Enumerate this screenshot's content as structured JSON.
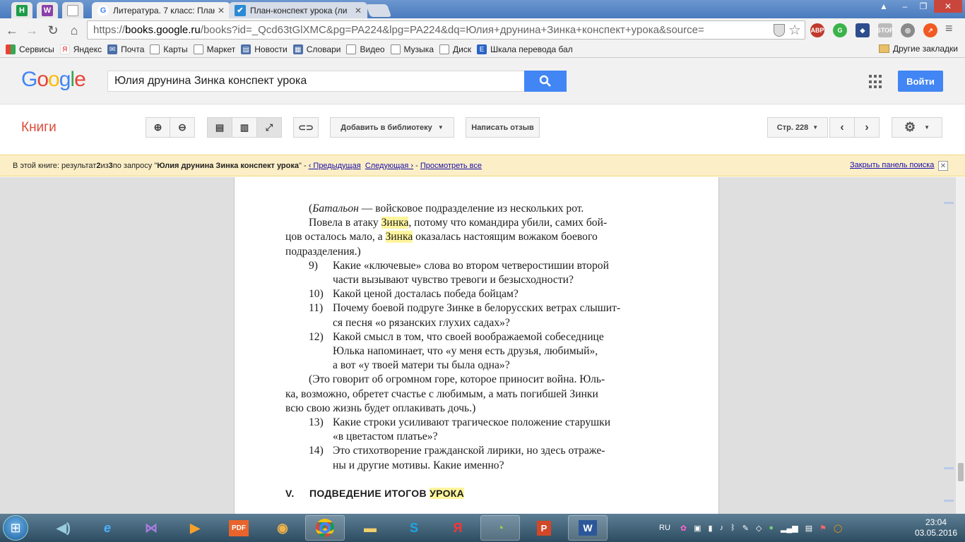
{
  "tabs": [
    {
      "title": "Литература. 7 класс: План",
      "favicon": "google-g-icon"
    },
    {
      "title": "План-конспект урока (ли",
      "favicon": "checkbox-icon"
    }
  ],
  "address": {
    "prefix": "https://",
    "domain": "books.google.ru",
    "path": "/books?id=_Qcd63tGlXMC&pg=PA224&lpg=PA224&dq=Юлия+друнина+Зинка+конспект+урока&source="
  },
  "bookmarks": [
    {
      "label": "Сервисы",
      "icon": "apps-icon",
      "color": "#e94235"
    },
    {
      "label": "Яндекс",
      "icon": "yandex-icon",
      "color": "#e51c23"
    },
    {
      "label": "Почта",
      "icon": "mail-icon",
      "color": "#4c6fa8"
    },
    {
      "label": "Карты",
      "icon": "page-icon",
      "color": "#ffffff"
    },
    {
      "label": "Маркет",
      "icon": "page-icon",
      "color": "#ffffff"
    },
    {
      "label": "Новости",
      "icon": "news-icon",
      "color": "#4c6fa8"
    },
    {
      "label": "Словари",
      "icon": "dictionary-icon",
      "color": "#4c6fa8"
    },
    {
      "label": "Видео",
      "icon": "page-icon",
      "color": "#ffffff"
    },
    {
      "label": "Музыка",
      "icon": "page-icon",
      "color": "#ffffff"
    },
    {
      "label": "Диск",
      "icon": "page-icon",
      "color": "#ffffff"
    },
    {
      "label": "Шкала перевода бал",
      "icon": "scale-icon",
      "color": "#2a64c5"
    }
  ],
  "other_bookmarks": "Другие закладки",
  "google": {
    "logo": "Google",
    "search_value": "Юлия друнина Зинка конспект урока",
    "signin": "Войти"
  },
  "books": {
    "label": "Книги",
    "add_library": "Добавить в библиотеку",
    "write_review": "Написать отзыв",
    "page_select": "Стр. 228"
  },
  "results_bar": {
    "prefix": "В этой книге: результат ",
    "current": "2",
    "of": " из ",
    "total": "3",
    "query_prefix": " по запросу \"",
    "query": "Юлия друнина Зинка конспект урока",
    "query_suffix": "\"",
    "sep1": " - ",
    "prev": "‹ Предыдущая",
    "next": "Следующая ›",
    "sep2": " - ",
    "view_all": "Просмотреть все",
    "close": "Закрыть панель поиска"
  },
  "book_text": {
    "l1a": "(",
    "l1b": "Батальон",
    "l1c": " — войсковое подразделение из нескольких рот.",
    "l2a": "Повела в атаку ",
    "l2hl": "Зинка",
    "l2b": ", потому что командира убили, самих бой-",
    "l3a": "цов осталось мало, а ",
    "l3hl": "Зинка",
    "l3b": " оказалась настоящим вожаком боевого",
    "l4": "подразделения.)",
    "q9n": "9)",
    "q9a": "Какие «ключевые» слова во втором четверостишии второй",
    "q9b": "части вызывают чувство тревоги и безысходности?",
    "q10n": "10)",
    "q10a": "Какой ценой досталась победа бойцам?",
    "q11n": "11)",
    "q11a": "Почему боевой подруге Зинке в белорусских ветрах слышит-",
    "q11b": "ся песня «о рязанских глухих садах»?",
    "q12n": "12)",
    "q12a": "Какой смысл в том, что своей воображаемой собеседнице",
    "q12b": "Юлька напоминает, что «у меня есть друзья, любимый»,",
    "q12c": "а вот «у твоей матери ты была одна»?",
    "p1": "(Это говорит об огромном горе, которое приносит война. Юль-",
    "p2": "ка, возможно, обретет счастье с любимым, а мать погибшей Зинки",
    "p3": "всю свою жизнь будет оплакивать дочь.)",
    "q13n": "13)",
    "q13a": "Какие строки усиливают трагическое положение старушки",
    "q13b": "«в цветастом платье»?",
    "q14n": "14)",
    "q14a": "Это стихотворение гражданской лирики, но здесь отраже-",
    "q14b": "ны и другие мотивы. Какие именно?",
    "sect_num": "V.",
    "sect_title": "ПОДВЕДЕНИЕ ИТОГОВ ",
    "sect_hl": "УРОКА"
  },
  "tray": {
    "lang": "RU",
    "time": "23:04",
    "date": "03.05.2016"
  },
  "colors": {
    "google_blue": "#4285f4",
    "books_red": "#dd4b39",
    "highlight": "#fff59d",
    "result_bar": "#fcefc7"
  }
}
